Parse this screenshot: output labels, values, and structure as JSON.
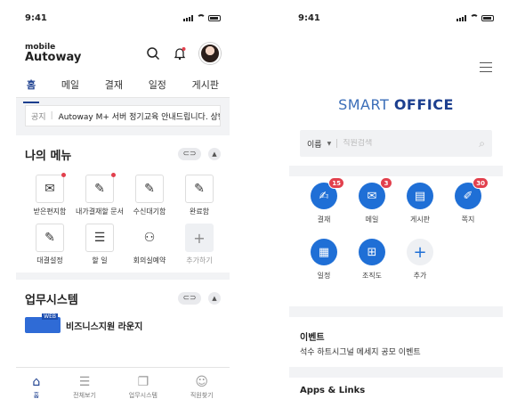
{
  "left": {
    "status": {
      "time": "9:41"
    },
    "logo": {
      "small": "mobile",
      "large": "Autoway"
    },
    "tabs": [
      "홈",
      "메일",
      "결재",
      "일정",
      "게시판"
    ],
    "notice": {
      "label": "공지",
      "text": "Autoway M+ 서버 정기교육 안내드립니다. 상반"
    },
    "my_menu": {
      "title": "나의 메뉴",
      "items": [
        {
          "label": "받은편지함",
          "icon": "mail-icon",
          "dot": true
        },
        {
          "label": "내가결재할 문서",
          "icon": "approve-doc-icon",
          "dot": true
        },
        {
          "label": "수신대기함",
          "icon": "inbox-edit-icon",
          "dot": false
        },
        {
          "label": "완료함",
          "icon": "completed-icon",
          "dot": false
        },
        {
          "label": "대결설정",
          "icon": "delegate-icon",
          "dot": false
        },
        {
          "label": "할 일",
          "icon": "todo-list-icon",
          "dot": false
        },
        {
          "label": "회의실예약",
          "icon": "meeting-room-icon",
          "dot": false
        },
        {
          "label": "추가하기",
          "icon": "plus-icon",
          "dot": false
        }
      ]
    },
    "business": {
      "title": "업무시스템",
      "web_badge": "WEB",
      "first_item": "비즈니스지원 라운지"
    },
    "bottom_nav": [
      "홈",
      "전체보기",
      "업무시스템",
      "직원찾기"
    ]
  },
  "right": {
    "status": {
      "time": "9:41"
    },
    "brand": {
      "part1": "SMART",
      "part2": "OFFICE"
    },
    "search": {
      "scope": "이름",
      "placeholder": "직원검색"
    },
    "apps": [
      {
        "label": "결재",
        "icon": "approval-icon",
        "badge": "15"
      },
      {
        "label": "메일",
        "icon": "mail-icon",
        "badge": "3"
      },
      {
        "label": "게시판",
        "icon": "board-icon",
        "badge": ""
      },
      {
        "label": "쪽지",
        "icon": "note-icon",
        "badge": "30"
      },
      {
        "label": "일정",
        "icon": "calendar-icon",
        "badge": ""
      },
      {
        "label": "조직도",
        "icon": "org-chart-icon",
        "badge": ""
      },
      {
        "label": "추가",
        "icon": "plus-icon",
        "badge": ""
      }
    ],
    "event": {
      "title": "이벤트",
      "text": "석수 하트시그널 메세지 공모 이벤트"
    },
    "apps_links": {
      "title": "Apps & Links"
    }
  }
}
